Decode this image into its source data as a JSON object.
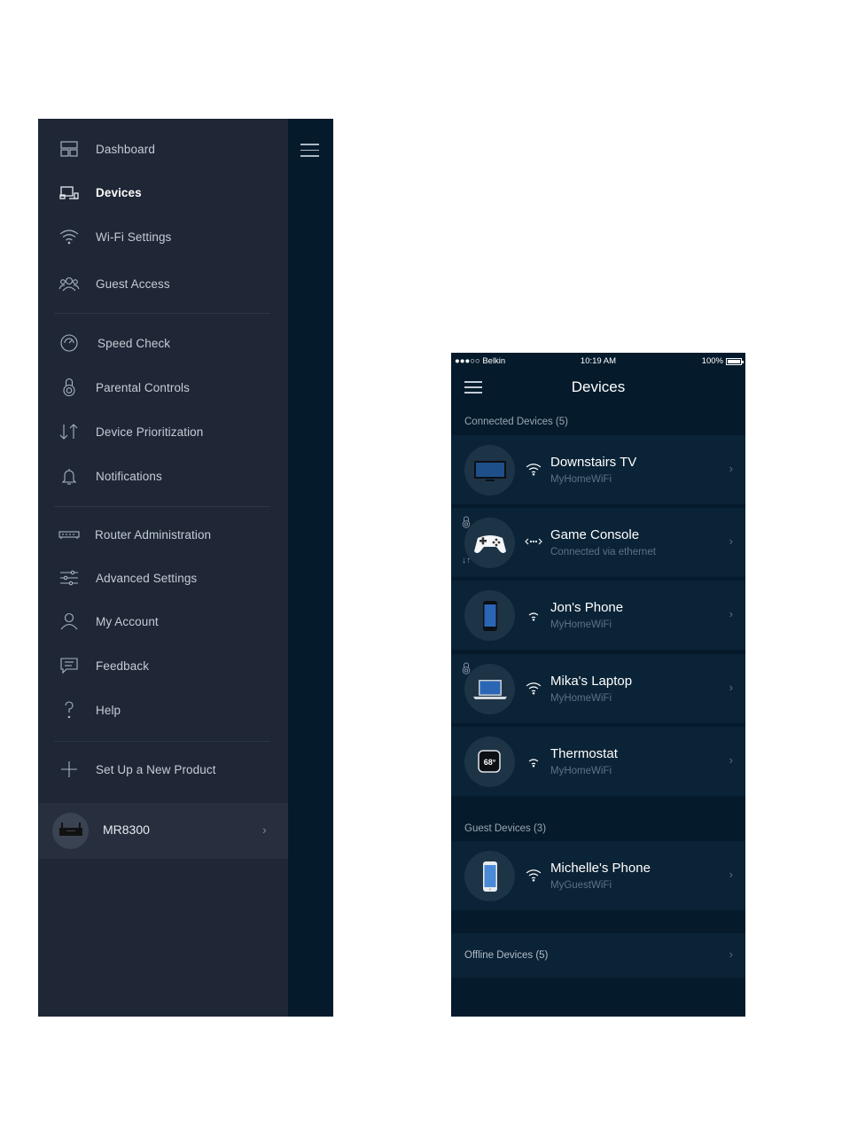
{
  "drawer": {
    "items_group1": [
      {
        "label": "Dashboard",
        "icon": "dashboard-icon",
        "active": false
      },
      {
        "label": "Devices",
        "icon": "devices-icon",
        "active": true
      },
      {
        "label": "Wi-Fi Settings",
        "icon": "wifi-icon",
        "active": false
      },
      {
        "label": "Guest Access",
        "icon": "guest-icon",
        "active": false
      }
    ],
    "items_group2": [
      {
        "label": "Speed Check",
        "icon": "speedometer-icon"
      },
      {
        "label": "Parental Controls",
        "icon": "lock-icon"
      },
      {
        "label": "Device Prioritization",
        "icon": "priority-arrows-icon"
      },
      {
        "label": "Notifications",
        "icon": "bell-icon"
      }
    ],
    "items_group3": [
      {
        "label": "Router Administration",
        "icon": "router-icon"
      },
      {
        "label": "Advanced Settings",
        "icon": "sliders-icon"
      },
      {
        "label": "My Account",
        "icon": "person-icon"
      },
      {
        "label": "Feedback",
        "icon": "chat-icon"
      },
      {
        "label": "Help",
        "icon": "question-icon"
      }
    ],
    "setup": {
      "label": "Set Up a New Product",
      "icon": "plus-icon"
    },
    "router": {
      "name": "MR8300",
      "icon": "router-image"
    }
  },
  "phone": {
    "status": {
      "carrier": "●●●○○ Belkin",
      "time": "10:19 AM",
      "battery": "100%"
    },
    "title": "Devices",
    "connected_header": "Connected Devices (5)",
    "connected": [
      {
        "name": "Downstairs TV",
        "sub": "MyHomeWiFi",
        "icon": "tv-icon",
        "conn": "wifi"
      },
      {
        "name": "Game Console",
        "sub": "Connected via ethernet",
        "icon": "gamepad-icon",
        "conn": "ethernet"
      },
      {
        "name": "Jon's Phone",
        "sub": "MyHomeWiFi",
        "icon": "phone-icon",
        "conn": "wifi"
      },
      {
        "name": "Mika's Laptop",
        "sub": "MyHomeWiFi",
        "icon": "laptop-icon",
        "conn": "wifi"
      },
      {
        "name": "Thermostat",
        "sub": "MyHomeWiFi",
        "icon": "thermostat-icon",
        "conn": "wifi",
        "temp": "68°"
      }
    ],
    "guest_header": "Guest Devices (3)",
    "guest": [
      {
        "name": "Michelle's Phone",
        "sub": "MyGuestWiFi",
        "icon": "phone-icon",
        "conn": "wifi"
      }
    ],
    "offline_label": "Offline Devices (5)"
  }
}
